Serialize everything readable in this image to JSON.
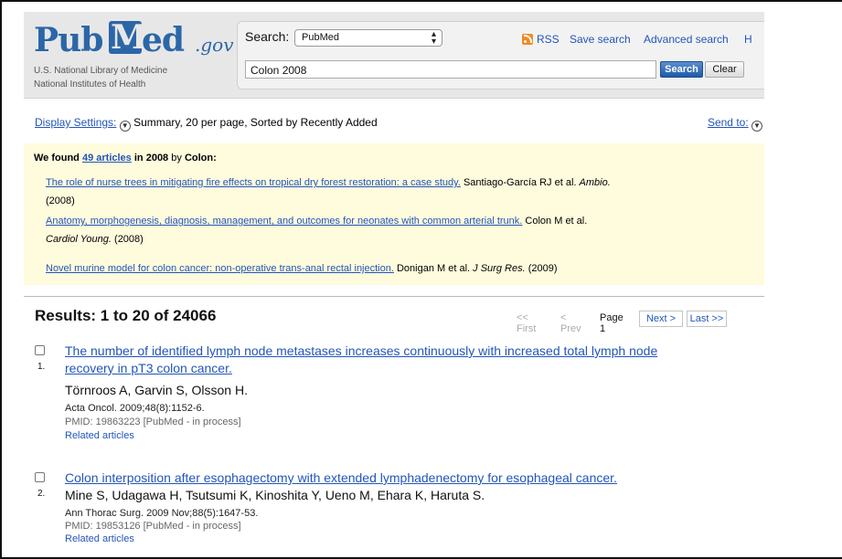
{
  "header": {
    "logo_pub": "Pub",
    "logo_m": "M",
    "logo_ed": "ed",
    "logo_gov": ".gov",
    "org_line1": "U.S. National Library of Medicine",
    "org_line2": "National Institutes of Health",
    "search_label": "Search:",
    "database": "PubMed",
    "query": "Colon 2008",
    "search_button": "Search",
    "clear_button": "Clear",
    "links": {
      "rss": "RSS",
      "save_search": "Save search",
      "advanced_search": "Advanced search",
      "help_partial": "H"
    },
    "colors": {
      "brand": "#2b66a8",
      "rss": "#f08a24",
      "link": "#2255bb"
    }
  },
  "display": {
    "settings_label": "Display Settings:",
    "summary": "Summary, 20 per page, Sorted by Recently Added",
    "send_to": "Send to:"
  },
  "suggestion": {
    "prefix": "We found",
    "count_link": "49 articles",
    "middle": "in",
    "year": "2008",
    "by": "by",
    "term": "Colon:",
    "items": [
      {
        "title": "The role of nurse trees in mitigating fire effects on tropical dry forest restoration: a case study.",
        "authors": "Santiago-García RJ et al.",
        "journal": "Ambio.",
        "year": "(2008)"
      },
      {
        "title": "Anatomy, morphogenesis, diagnosis, management, and outcomes for neonates with common arterial trunk.",
        "authors": "Colon M et al.",
        "journal": "Cardiol Young.",
        "year": "(2008)"
      },
      {
        "title": "Novel murine model for colon cancer: non-operative trans-anal rectal injection.",
        "authors": "Donigan M et al.",
        "journal": "J Surg Res.",
        "year": "(2009)"
      }
    ]
  },
  "results": {
    "title": "Results: 1 to 20 of 24066",
    "pager": {
      "first": "<< First",
      "prev": "< Prev",
      "page": "Page 1",
      "next": "Next >",
      "last": "Last >>"
    },
    "items": [
      {
        "number": "1.",
        "title_line1": "The number of identified lymph node metastases increases continuously with increased total lymph node",
        "title_line2": "recovery in pT3 colon cancer.",
        "authors": "Törnroos A, Garvin S, Olsson H.",
        "journal": "Acta Oncol. 2009;48(8):1152-6.",
        "pmid": "PMID: 19863223 [PubMed - in process]",
        "related": "Related articles"
      },
      {
        "number": "2.",
        "title_line1": "Colon interposition after esophagectomy with extended lymphadenectomy for esophageal cancer.",
        "authors": "Mine S, Udagawa H, Tsutsumi K, Kinoshita Y, Ueno M, Ehara K, Haruta S.",
        "journal": "Ann Thorac Surg. 2009 Nov;88(5):1647-53.",
        "pmid": "PMID: 19853126 [PubMed - in process]",
        "related": "Related articles"
      }
    ]
  }
}
